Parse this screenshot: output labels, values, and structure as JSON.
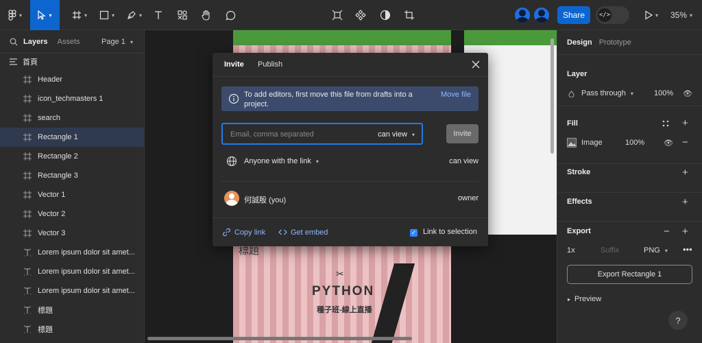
{
  "toolbar": {
    "share_label": "Share",
    "zoom_label": "35%",
    "devmode_glyph": "</>"
  },
  "left_panel": {
    "tab_layers": "Layers",
    "tab_assets": "Assets",
    "page_selector": "Page 1",
    "page_root": "首頁",
    "layers": [
      {
        "label": "Header",
        "icon": "frame-icon"
      },
      {
        "label": "icon_techmasters 1",
        "icon": "frame-icon"
      },
      {
        "label": "search",
        "icon": "frame-icon"
      },
      {
        "label": "Rectangle 1",
        "icon": "frame-icon"
      },
      {
        "label": "Rectangle 2",
        "icon": "frame-icon"
      },
      {
        "label": "Rectangle 3",
        "icon": "frame-icon"
      },
      {
        "label": "Vector 1",
        "icon": "frame-icon"
      },
      {
        "label": "Vector 2",
        "icon": "frame-icon"
      },
      {
        "label": "Vector 3",
        "icon": "frame-icon"
      },
      {
        "label": "Lorem ipsum dolor sit amet...",
        "icon": "text-icon"
      },
      {
        "label": "Lorem ipsum dolor sit amet...",
        "icon": "text-icon"
      },
      {
        "label": "Lorem ipsum dolor sit amet...",
        "icon": "text-icon"
      },
      {
        "label": "標題",
        "icon": "text-icon"
      },
      {
        "label": "標題",
        "icon": "text-icon"
      }
    ]
  },
  "canvas": {
    "title_text": "標題",
    "poster_title": "PYTHON",
    "poster_subtitle": "種子班-線上直播"
  },
  "modal": {
    "tab_invite": "Invite",
    "tab_publish": "Publish",
    "banner_text": "To add editors, first move this file from drafts into a project.",
    "banner_link": "Move file",
    "email_placeholder": "Email, comma separated",
    "permission": "can view",
    "invite_button": "Invite",
    "link_scope": "Anyone with the link",
    "link_permission": "can view",
    "user_name": "何誠殷 (you)",
    "user_role": "owner",
    "copy_link": "Copy link",
    "get_embed": "Get embed",
    "link_to_selection": "Link to selection",
    "link_to_selection_checked": true
  },
  "right_panel": {
    "tab_design": "Design",
    "tab_prototype": "Prototype",
    "layer_title": "Layer",
    "blend_mode": "Pass through",
    "layer_opacity": "100%",
    "fill_title": "Fill",
    "fill_type": "Image",
    "fill_opacity": "100%",
    "stroke_title": "Stroke",
    "effects_title": "Effects",
    "export_title": "Export",
    "export_scale": "1x",
    "export_suffix_placeholder": "Suffix",
    "export_format": "PNG",
    "export_button": "Export Rectangle 1",
    "preview_label": "Preview",
    "help_glyph": "?"
  },
  "colors": {
    "accent": "#0d66d0",
    "selection": "#2f3a4e",
    "link": "#8fb6ff",
    "banner": "#3c4b6c"
  }
}
